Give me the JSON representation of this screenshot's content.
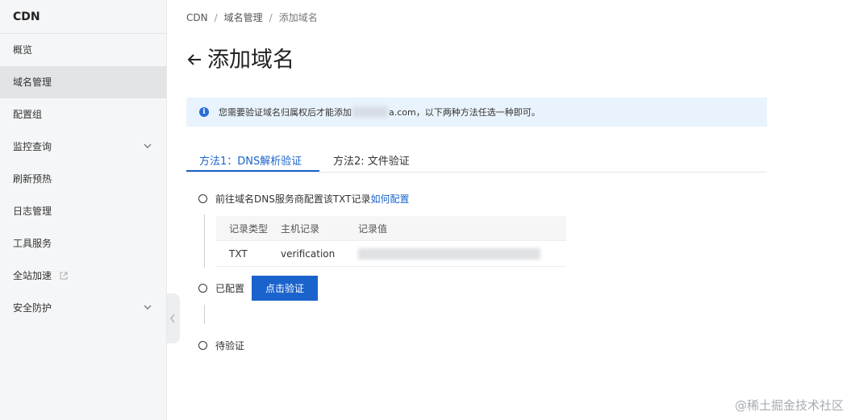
{
  "sidebar": {
    "title": "CDN",
    "items": [
      {
        "label": "概览"
      },
      {
        "label": "域名管理"
      },
      {
        "label": "配置组"
      },
      {
        "label": "监控查询"
      },
      {
        "label": "刷新预热"
      },
      {
        "label": "日志管理"
      },
      {
        "label": "工具服务"
      },
      {
        "label": "全站加速"
      },
      {
        "label": "安全防护"
      }
    ]
  },
  "breadcrumb": {
    "root": "CDN",
    "parent": "域名管理",
    "current": "添加域名"
  },
  "page": {
    "title": "添加域名"
  },
  "notice": {
    "prefix": "您需要验证域名归属权后才能添加",
    "suffix": "a.com，以下两种方法任选一种即可。"
  },
  "tabs": [
    {
      "label": "方法1：DNS解析验证"
    },
    {
      "label": "方法2: 文件验证"
    }
  ],
  "steps": {
    "step1_text": "前往域名DNS服务商配置该TXT记录",
    "step1_link": "如何配置",
    "step2_text": "已配置",
    "step2_button": "点击验证",
    "step3_text": "待验证"
  },
  "record_table": {
    "headers": [
      "记录类型",
      "主机记录",
      "记录值"
    ],
    "row": {
      "type": "TXT",
      "host": "verification"
    }
  },
  "watermark": "@稀土掘金技术社区",
  "colors": {
    "accent": "#1b63cc",
    "notice_bg": "#e9f3fd",
    "sidebar_bg": "#f5f6f7"
  }
}
